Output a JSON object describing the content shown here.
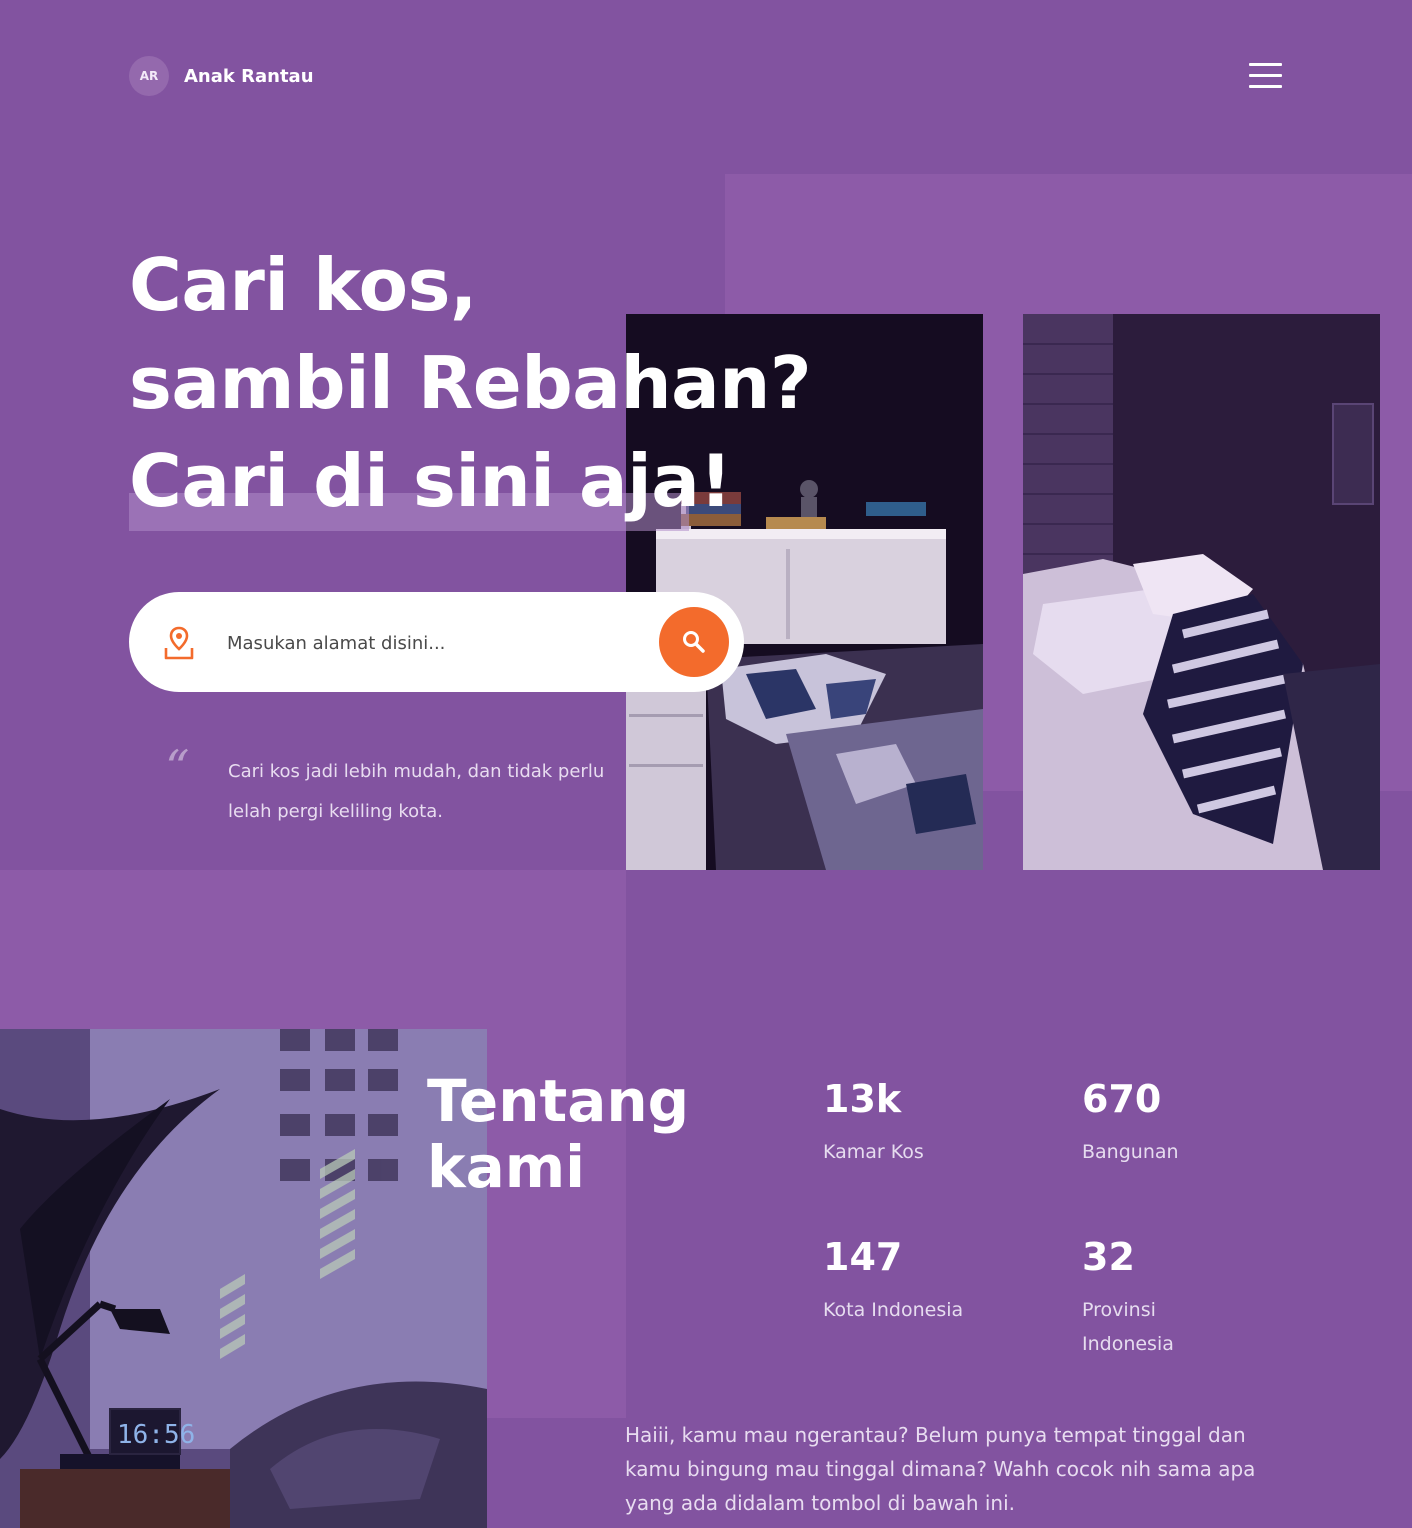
{
  "header": {
    "logo_initials": "AR",
    "logo_name": "Anak Rantau",
    "menu_icon": "hamburger-menu-icon"
  },
  "hero": {
    "title_lines": [
      "Cari kos,",
      "sambil Rebahan?",
      "Cari di sini aja!"
    ],
    "search": {
      "placeholder": "Masukan alamat disini...",
      "location_icon": "location-pin-icon",
      "search_icon": "magnifier-icon"
    },
    "quote": "Cari kos jadi lebih mudah, dan tidak perlu lelah pergi keliling kota."
  },
  "about": {
    "title_lines": [
      "Tentang",
      "kami"
    ],
    "stats": [
      {
        "value": "13k",
        "label": "Kamar Kos"
      },
      {
        "value": "670",
        "label": "Bangunan"
      },
      {
        "value": "147",
        "label": "Kota Indonesia"
      },
      {
        "value": "32",
        "label": "Provinsi Indonesia"
      }
    ],
    "description": "Haiii, kamu mau ngerantau? Belum punya tempat tinggal dan kamu bingung mau tinggal dimana? Wahh cocok nih sama apa yang ada didalam tombol di bawah ini."
  },
  "colors": {
    "background": "#8253a0",
    "panel": "#8d5ba8",
    "accent": "#f36b2c"
  }
}
